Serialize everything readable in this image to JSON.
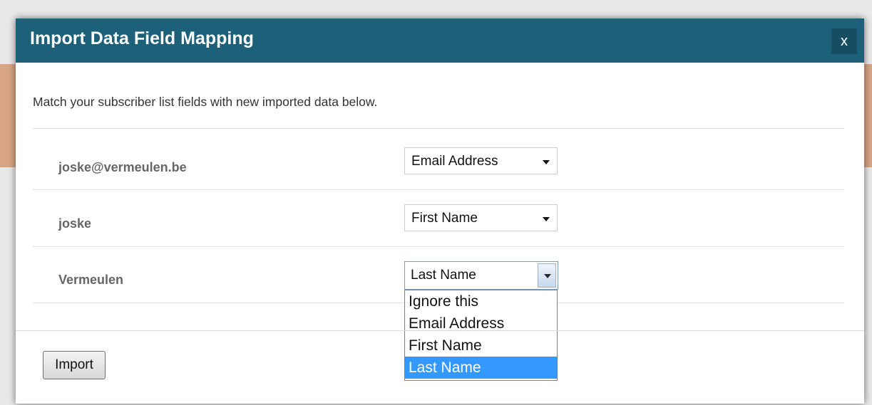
{
  "modal": {
    "title": "Import Data Field Mapping",
    "close_label": "x",
    "intro": "Match your subscriber list fields with new imported data below.",
    "rows": [
      {
        "label": "joske@vermeulen.be",
        "selected": "Email Address"
      },
      {
        "label": "joske",
        "selected": "First Name"
      },
      {
        "label": "Vermeulen",
        "selected": "Last Name"
      }
    ],
    "dropdown_options": [
      "Ignore this",
      "Email Address",
      "First Name",
      "Last Name"
    ],
    "dropdown_selected_index": 3,
    "import_label": "Import"
  },
  "colors": {
    "header": "#1d6079",
    "option_highlight": "#3399ff",
    "background_band": "#d9a585"
  }
}
